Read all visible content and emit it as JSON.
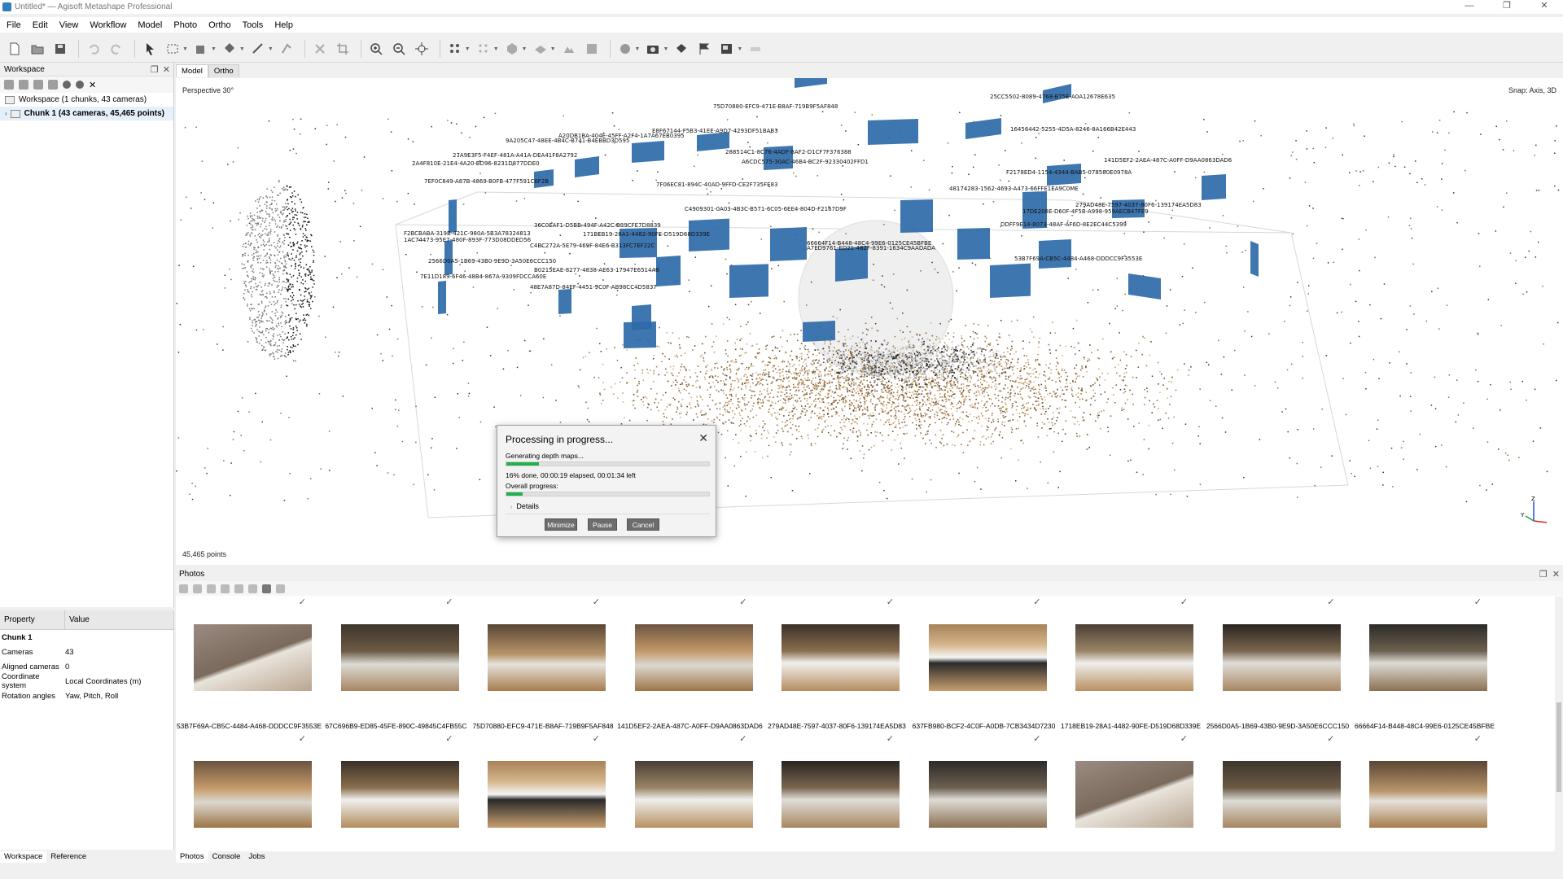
{
  "window": {
    "title": "Untitled* — Agisoft Metashape Professional",
    "controls": [
      "—",
      "❐",
      "✕"
    ]
  },
  "menu": [
    "File",
    "Edit",
    "View",
    "Workflow",
    "Model",
    "Photo",
    "Ortho",
    "Tools",
    "Help"
  ],
  "workspace": {
    "title": "Workspace",
    "root_label": "Workspace (1 chunks, 43 cameras)",
    "chunk_label": "Chunk 1 (43 cameras, 45,465 points)"
  },
  "properties": {
    "col_property": "Property",
    "col_value": "Value",
    "section": "Chunk 1",
    "rows": [
      {
        "k": "Cameras",
        "v": "43"
      },
      {
        "k": "Aligned cameras",
        "v": "0"
      },
      {
        "k": "Coordinate system",
        "v": "Local Coordinates (m)"
      },
      {
        "k": "Rotation angles",
        "v": "Yaw, Pitch, Roll"
      }
    ]
  },
  "left_tabs": [
    "Workspace",
    "Reference"
  ],
  "model_tabs": [
    "Model",
    "Ortho"
  ],
  "viewport": {
    "perspective": "Perspective 30°",
    "snap": "Snap: Axis, 3D",
    "points": "45,465 points",
    "camera_labels": [
      "25CC5502-8089-4768-B75E-A0A12678E635",
      "75D70880-EFC9-471E-B8AF-719B9F5AF848",
      "16456442-5255-4D5A-8246-8A166B42E443",
      "E8F67144-F5B3-41EE-A9D7-4293DF51BAB3",
      "A20DB1BA-404E-45FF-A2F4-1A7A67EB0395",
      "9A205C47-48EE-4B4C-B741-B4EBBD3D595",
      "27A9E3F5-F4EF-481A-A41A-DEA41F8A2792",
      "2A4F810E-21E4-4A20-BD96-8231D877DDE0",
      "7EF0C849-A87B-4869-B0FB-477F591C6F2B",
      "288514C1-8C76-4ADF-8AF2-D1CF7F376388",
      "A6CDC575-30AC-46B4-BC2F-92330402FFD1",
      "141D5EF2-2AEA-487C-A0FF-D9AA0863DAD6",
      "F2178ED4-1154-4344-BAB5-078580E0978A",
      "7F06EC81-894C-40AD-9FFD-CE2F735FE83",
      "48174283-1562-4693-A473-66FFE1EA9C0ME",
      "279AD48E-7597-4037-80F6-139174EA5D83",
      "17DE208E-D60F-4F5B-A998-959AECB47FE9",
      "C4909301-0A03-4B3C-B571-6C05-6EE4-804D-F2167D9F",
      "DDFF9E14-8073-48AF-AF6D-8E2EC44C5399",
      "36C0EAF1-D5BB-494F-A42C-B39CFE7D8839",
      "F2BCBABA-319B-421C-980A-5B3A78324813",
      "1AC74473-95E7-480F-893F-773D08DDED56",
      "171BEB19-28A1-4482-90FE-D519D68D339E",
      "66664F14-B448-48C4-99E6-0125CE45BFBE",
      "C4BC272A-5E79-469F-84E6-B313FC7EF22C",
      "A7ED9761-ED21-482F-8391-1634C9AADADA",
      "53B7F69A-CB5C-4484-A468-DDDCC9F3553E",
      "2566D0A5-1B69-43B0-9E9D-3A50E6CCC150",
      "B0215EAE-8277-4838-AE63-17947E6514A8",
      "7E11D189-6F46-48B4-867A-9309FDCCA60E",
      "48E7A87D-84EF-4451-9C0F-AB98CC4D5837"
    ]
  },
  "dialog": {
    "title": "Processing in progress...",
    "stage": "Generating depth maps...",
    "stage_progress": 0.16,
    "status": "16% done, 00:00:19 elapsed, 00:01:34 left",
    "overall_label": "Overall progress:",
    "overall_progress": 0.08,
    "details": "Details",
    "btn_minimize": "Minimize",
    "btn_pause": "Pause",
    "btn_cancel": "Cancel"
  },
  "photos": {
    "title": "Photos",
    "row1_captions": [
      "53B7F69A-CB5C-4484-A468-DDDCC9F3553E",
      "67C696B9-ED85-45FE-890C-49845C4FB55C",
      "75D70880-EFC9-471E-B8AF-719B9F5AF848",
      "141D5EF2-2AEA-487C-A0FF-D9AA0863DAD6",
      "279AD48E-7597-4037-80F6-139174EA5D83",
      "637FB980-BCF2-4C0F-A0DB-7CB3434D7230",
      "1718EB19-28A1-4482-90FE-D519D68D339E",
      "2566D0A5-1B69-43B0-9E9D-3A50E6CCC150",
      "66664F14-B448-48C4-99E6-0125CE45BFBE"
    ],
    "check": "✓"
  },
  "bottom_tabs": [
    "Photos",
    "Console",
    "Jobs"
  ],
  "colors": {
    "camera_plane": "#2e6aa8",
    "progress": "#22b14c",
    "dialog_button": "#6d6d6d"
  }
}
